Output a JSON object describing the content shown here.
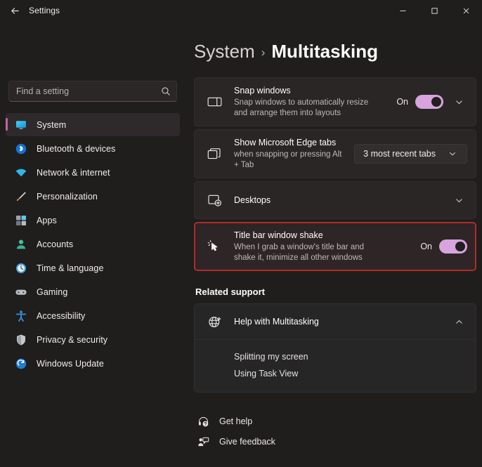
{
  "window": {
    "title": "Settings",
    "back_icon": "back-arrow-icon",
    "minimize_label": "Minimize",
    "maximize_label": "Maximize",
    "close_label": "Close"
  },
  "search": {
    "placeholder": "Find a setting",
    "value": "",
    "icon": "search-icon"
  },
  "sidebar": {
    "items": [
      {
        "label": "System",
        "icon": "monitor-icon",
        "selected": true
      },
      {
        "label": "Bluetooth & devices",
        "icon": "bluetooth-icon",
        "selected": false
      },
      {
        "label": "Network & internet",
        "icon": "wifi-icon",
        "selected": false
      },
      {
        "label": "Personalization",
        "icon": "paintbrush-icon",
        "selected": false
      },
      {
        "label": "Apps",
        "icon": "apps-grid-icon",
        "selected": false
      },
      {
        "label": "Accounts",
        "icon": "person-icon",
        "selected": false
      },
      {
        "label": "Time & language",
        "icon": "clock-icon",
        "selected": false
      },
      {
        "label": "Gaming",
        "icon": "gamepad-icon",
        "selected": false
      },
      {
        "label": "Accessibility",
        "icon": "accessibility-icon",
        "selected": false
      },
      {
        "label": "Privacy & security",
        "icon": "shield-icon",
        "selected": false
      },
      {
        "label": "Windows Update",
        "icon": "update-refresh-icon",
        "selected": false
      }
    ]
  },
  "breadcrumb": {
    "parent": "System",
    "separator": "›",
    "current": "Multitasking"
  },
  "settings": [
    {
      "id": "snap-windows",
      "icon": "snap-layout-icon",
      "title": "Snap windows",
      "subtitle": "Snap windows to automatically resize and arrange them into layouts",
      "control": "toggle",
      "toggle_label": "On",
      "toggle_on": true,
      "has_expander": true,
      "expander_icon": "chevron-down-icon",
      "highlighted": false
    },
    {
      "id": "edge-tabs",
      "icon": "window-stack-icon",
      "title": "Show Microsoft Edge tabs",
      "subtitle": "when snapping or pressing Alt + Tab",
      "control": "dropdown",
      "dropdown_value": "3 most recent tabs",
      "dropdown_icon": "chevron-down-icon",
      "has_expander": false,
      "highlighted": false
    },
    {
      "id": "desktops",
      "icon": "desktop-add-icon",
      "title": "Desktops",
      "subtitle": "",
      "control": "none",
      "has_expander": true,
      "expander_icon": "chevron-down-icon",
      "highlighted": false
    },
    {
      "id": "title-bar-window-shake",
      "icon": "cursor-shake-icon",
      "title": "Title bar window shake",
      "subtitle": "When I grab a window's title bar and shake it, minimize all other windows",
      "control": "toggle",
      "toggle_label": "On",
      "toggle_on": true,
      "has_expander": false,
      "highlighted": true
    }
  ],
  "related_support": {
    "heading": "Related support",
    "card": {
      "icon": "globe-help-icon",
      "title": "Help with Multitasking",
      "expander_icon": "chevron-up-icon",
      "expanded": true,
      "links": [
        {
          "label": "Splitting my screen"
        },
        {
          "label": "Using Task View"
        }
      ]
    }
  },
  "footer": {
    "items": [
      {
        "label": "Get help",
        "icon": "help-headset-icon"
      },
      {
        "label": "Give feedback",
        "icon": "feedback-icon"
      }
    ]
  },
  "colors": {
    "page_background": "#201d1d",
    "card_background": "#2a2626",
    "accent_toggle": "#d7a4dd",
    "selection_accent": "#c95fa8",
    "highlight_border": "#b02b2b",
    "cursor": "#a24fd0"
  }
}
